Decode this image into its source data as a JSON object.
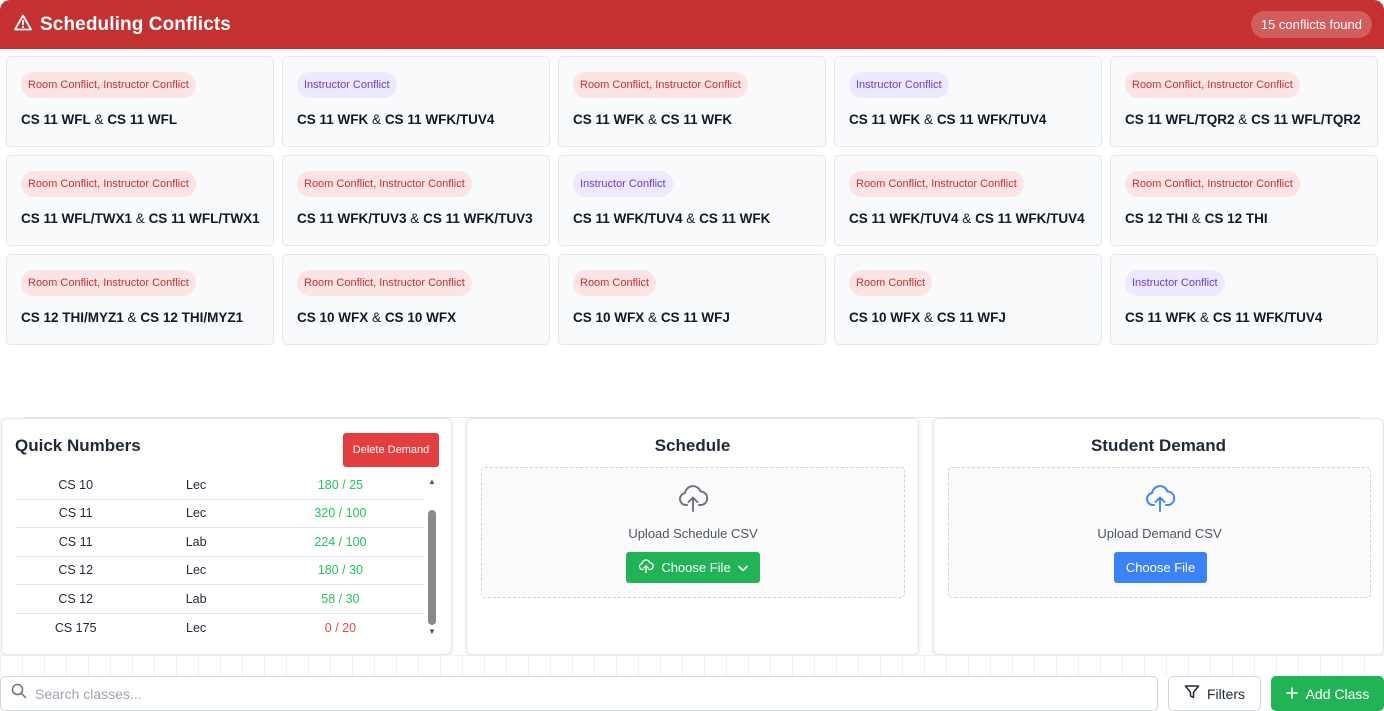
{
  "conflicts": {
    "title": "Scheduling Conflicts",
    "count_label": "15 conflicts found",
    "separator": "&",
    "items": [
      {
        "tag": "Room Conflict, Instructor Conflict",
        "a": "CS 11 WFL",
        "b": "CS 11 WFL"
      },
      {
        "tag": "Instructor Conflict",
        "a": "CS 11 WFK",
        "b": "CS 11 WFK/TUV4"
      },
      {
        "tag": "Room Conflict, Instructor Conflict",
        "a": "CS 11 WFK",
        "b": "CS 11 WFK"
      },
      {
        "tag": "Instructor Conflict",
        "a": "CS 11 WFK",
        "b": "CS 11 WFK/TUV4"
      },
      {
        "tag": "Room Conflict, Instructor Conflict",
        "a": "CS 11 WFL/TQR2",
        "b": "CS 11 WFL/TQR2"
      },
      {
        "tag": "Room Conflict, Instructor Conflict",
        "a": "CS 11 WFL/TWX1",
        "b": "CS 11 WFL/TWX1"
      },
      {
        "tag": "Room Conflict, Instructor Conflict",
        "a": "CS 11 WFK/TUV3",
        "b": "CS 11 WFK/TUV3"
      },
      {
        "tag": "Instructor Conflict",
        "a": "CS 11 WFK/TUV4",
        "b": "CS 11 WFK"
      },
      {
        "tag": "Room Conflict, Instructor Conflict",
        "a": "CS 11 WFK/TUV4",
        "b": "CS 11 WFK/TUV4"
      },
      {
        "tag": "Room Conflict, Instructor Conflict",
        "a": "CS 12 THI",
        "b": "CS 12 THI"
      },
      {
        "tag": "Room Conflict, Instructor Conflict",
        "a": "CS 12 THI/MYZ1",
        "b": "CS 12 THI/MYZ1"
      },
      {
        "tag": "Room Conflict, Instructor Conflict",
        "a": "CS 10 WFX",
        "b": "CS 10 WFX"
      },
      {
        "tag": "Room Conflict",
        "a": "CS 10 WFX",
        "b": "CS 11 WFJ"
      },
      {
        "tag": "Room Conflict",
        "a": "CS 10 WFX",
        "b": "CS 11 WFJ"
      },
      {
        "tag": "Instructor Conflict",
        "a": "CS 11 WFK",
        "b": "CS 11 WFK/TUV4"
      }
    ]
  },
  "quick_numbers": {
    "title": "Quick Numbers",
    "delete_label": "Delete Demand",
    "rows": [
      {
        "course": "CS 10",
        "type": "Lec",
        "count": "180 / 25"
      },
      {
        "course": "CS 11",
        "type": "Lec",
        "count": "320 / 100"
      },
      {
        "course": "CS 11",
        "type": "Lab",
        "count": "224 / 100"
      },
      {
        "course": "CS 12",
        "type": "Lec",
        "count": "180 / 30"
      },
      {
        "course": "CS 12",
        "type": "Lab",
        "count": "58 / 30"
      },
      {
        "course": "CS 175",
        "type": "Lec",
        "count": "0 / 20"
      }
    ]
  },
  "schedule": {
    "title": "Schedule",
    "upload_text": "Upload Schedule CSV",
    "button_label": "Choose File"
  },
  "demand": {
    "title": "Student Demand",
    "upload_text": "Upload Demand CSV",
    "button_label": "Choose File"
  },
  "toolbar": {
    "search_placeholder": "Search classes...",
    "filters_label": "Filters",
    "add_label": "Add Class"
  },
  "colors": {
    "header_red": "#c53030",
    "success_green": "#22b357",
    "primary_blue": "#3b82f6",
    "danger_red": "#e53e3e"
  },
  "icons": {
    "header": "warning-triangle-icon",
    "upload": "cloud-upload-icon",
    "search": "search-icon",
    "filter": "filter-icon",
    "add": "plus-icon",
    "dropdown": "chevron-down-icon"
  }
}
